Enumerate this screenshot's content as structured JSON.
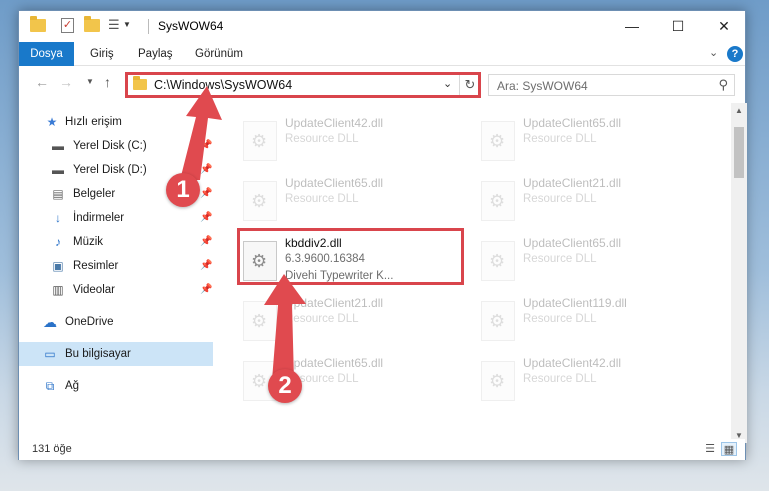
{
  "window": {
    "title": "SysWOW64"
  },
  "ribbon": {
    "tabs": [
      "Dosya",
      "Giriş",
      "Paylaş",
      "Görünüm"
    ],
    "expand_glyph": "⌄",
    "help_glyph": "?"
  },
  "nav": {
    "address": "C:\\Windows\\SysWOW64",
    "search_placeholder": "Ara: SysWOW64"
  },
  "sidebar": {
    "items": [
      {
        "label": "Hızlı erişim",
        "icon": "star-icon",
        "pinned": false
      },
      {
        "label": "Yerel Disk (C:)",
        "icon": "drive-icon",
        "pinned": true
      },
      {
        "label": "Yerel Disk (D:)",
        "icon": "drive-icon",
        "pinned": true
      },
      {
        "label": "Belgeler",
        "icon": "documents-icon",
        "pinned": true
      },
      {
        "label": "İndirmeler",
        "icon": "download-icon",
        "pinned": true
      },
      {
        "label": "Müzik",
        "icon": "music-icon",
        "pinned": true
      },
      {
        "label": "Resimler",
        "icon": "pictures-icon",
        "pinned": true
      },
      {
        "label": "Videolar",
        "icon": "videos-icon",
        "pinned": true
      },
      {
        "label": "OneDrive",
        "icon": "cloud-icon",
        "pinned": false
      },
      {
        "label": "Bu bilgisayar",
        "icon": "computer-icon",
        "pinned": false,
        "selected": true
      },
      {
        "label": "Ağ",
        "icon": "network-icon",
        "pinned": false
      }
    ]
  },
  "files": [
    {
      "name": "UpdateClient42.dll",
      "line2": "Resource DLL",
      "line3": ""
    },
    {
      "name": "UpdateClient65.dll",
      "line2": "Resource DLL",
      "line3": ""
    },
    {
      "name": "UpdateClient65.dll",
      "line2": "Resource DLL",
      "line3": ""
    },
    {
      "name": "UpdateClient21.dll",
      "line2": "Resource DLL",
      "line3": ""
    },
    {
      "name": "kbddiv2.dll",
      "line2": "6.3.9600.16384",
      "line3": "Divehi Typewriter K...",
      "highlighted": true
    },
    {
      "name": "UpdateClient65.dll",
      "line2": "Resource DLL",
      "line3": ""
    },
    {
      "name": "UpdateClient21.dll",
      "line2": "Resource DLL",
      "line3": ""
    },
    {
      "name": "UpdateClient119.dll",
      "line2": "Resource DLL",
      "line3": ""
    },
    {
      "name": "UpdateClient65.dll",
      "line2": "Resource DLL",
      "line3": ""
    },
    {
      "name": "UpdateClient42.dll",
      "line2": "Resource DLL",
      "line3": ""
    }
  ],
  "status": {
    "count": "131 öğe"
  },
  "annotations": [
    {
      "label": "1",
      "color": "#e04a4f"
    },
    {
      "label": "2",
      "color": "#e04a4f"
    }
  ]
}
